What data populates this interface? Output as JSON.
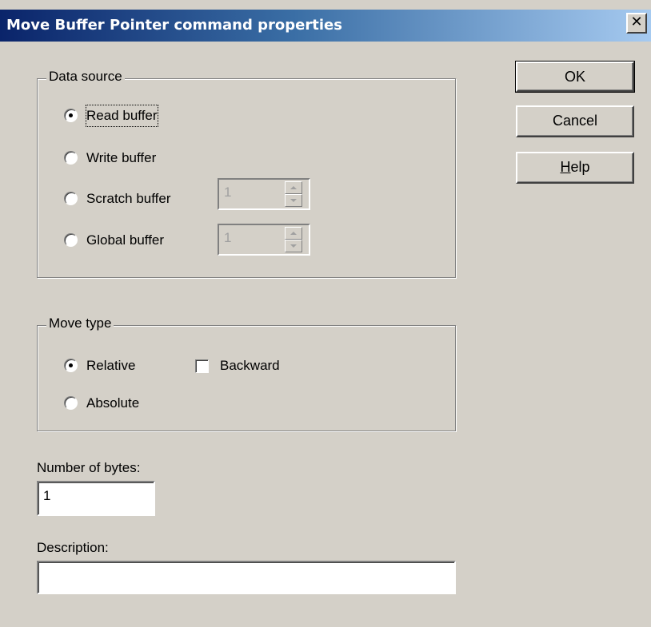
{
  "window": {
    "title": "Move Buffer Pointer command properties",
    "close_glyph": "✕"
  },
  "buttons": {
    "ok": "OK",
    "cancel": "Cancel",
    "help": "Help"
  },
  "data_source": {
    "label": "Data source",
    "options": [
      "Read buffer",
      "Write buffer",
      "Scratch buffer",
      "Global buffer"
    ],
    "selected": "Read buffer",
    "scratch_value": "1",
    "global_value": "1"
  },
  "move_type": {
    "label": "Move type",
    "options": [
      "Relative",
      "Absolute"
    ],
    "selected": "Relative",
    "backward_label": "Backward",
    "backward_checked": false
  },
  "number_of_bytes": {
    "label": "Number of bytes:",
    "value": "1"
  },
  "description": {
    "label": "Description:",
    "value": ""
  },
  "icons": {
    "close": "close-icon",
    "radio_selected": "radio-selected-icon",
    "spin_up": "spin-up-icon",
    "spin_down": "spin-down-icon"
  },
  "colors": {
    "title_start": "#0a246a",
    "title_end": "#a6caf0",
    "face": "#d4d0c8"
  }
}
